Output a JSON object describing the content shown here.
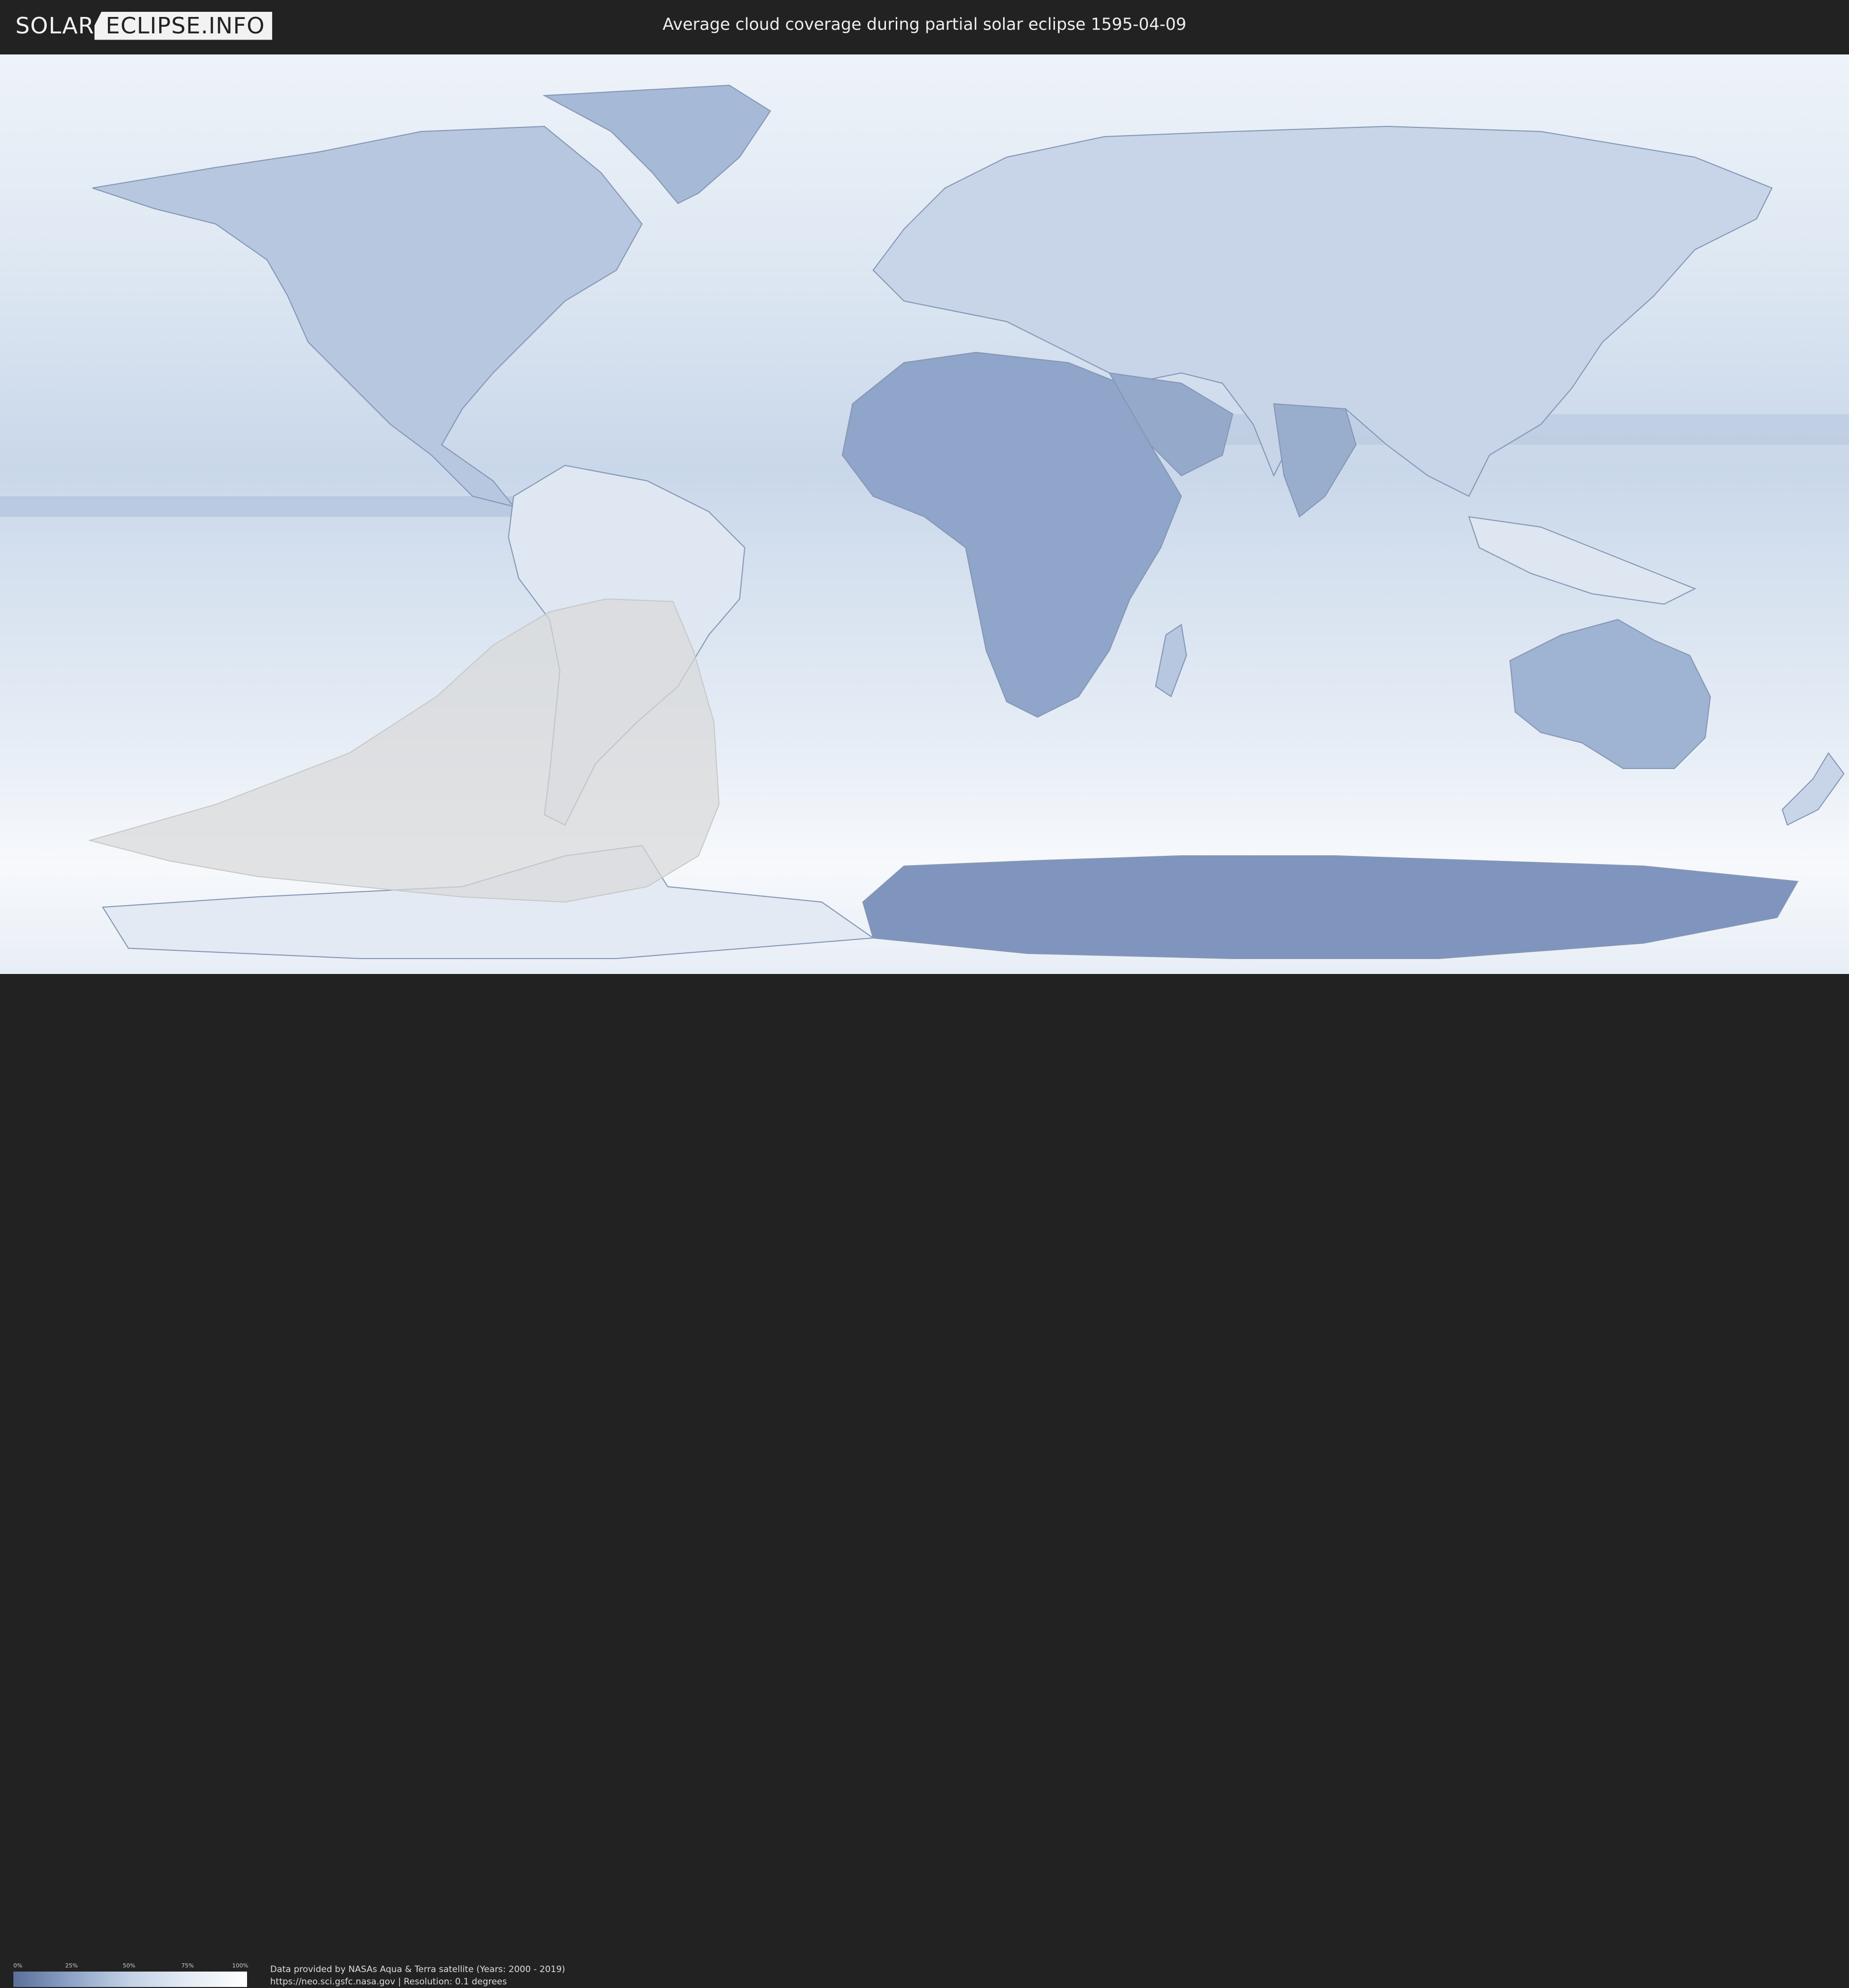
{
  "header": {
    "logo_left": "SOLAR",
    "logo_right": "ECLIPSE.INFO",
    "title": "Average cloud coverage during partial solar eclipse 1595-04-09"
  },
  "map": {
    "background_color": "#d7e2ef",
    "land_color": "#9fb3d3",
    "eclipse_zone_color": "#d8d8d8"
  },
  "legend": {
    "ticks": [
      "0%",
      "25%",
      "50%",
      "75%",
      "100%"
    ],
    "colors": [
      "#5a6f9a",
      "#8ea4c8",
      "#c4d2e6",
      "#e4ebf5",
      "#ffffff"
    ]
  },
  "footer": {
    "credit_line1": "Data provided by NASAs Aqua & Terra satellite (Years: 2000 - 2019)",
    "credit_line2": "https://neo.sci.gsfc.nasa.gov | Resolution: 0.1 degrees"
  }
}
